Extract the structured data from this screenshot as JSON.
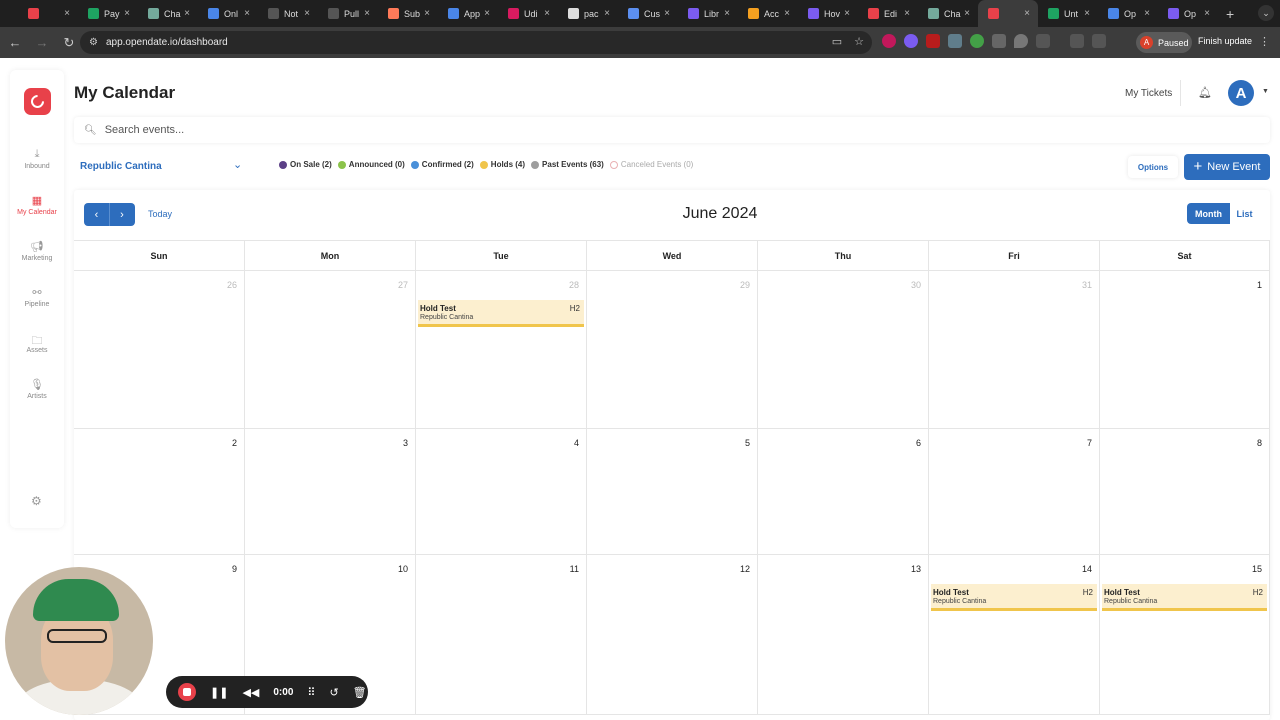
{
  "browser": {
    "tabs": [
      {
        "label": "",
        "icon": "chrome-icon",
        "color": "#e8414a"
      },
      {
        "label": "Pay",
        "icon": "sheets-icon",
        "color": "#1ea362"
      },
      {
        "label": "Cha",
        "icon": "chatgpt-icon",
        "color": "#74aa9c"
      },
      {
        "label": "Onl",
        "icon": "docs-icon",
        "color": "#4a86e8"
      },
      {
        "label": "Not",
        "icon": "github-icon",
        "color": "#555555"
      },
      {
        "label": "Pull",
        "icon": "github-icon",
        "color": "#555555"
      },
      {
        "label": "Sub",
        "icon": "hubspot-icon",
        "color": "#ff7a59"
      },
      {
        "label": "App",
        "icon": "app-icon",
        "color": "#4a86e8"
      },
      {
        "label": "Udi",
        "icon": "udi-icon",
        "color": "#d81b60"
      },
      {
        "label": "pac",
        "icon": "google-icon",
        "color": "#dddddd"
      },
      {
        "label": "Cus",
        "icon": "cube-icon",
        "color": "#5c8ff0"
      },
      {
        "label": "Libr",
        "icon": "gear-color-icon",
        "color": "#7b5cf0"
      },
      {
        "label": "Acc",
        "icon": "acc-icon",
        "color": "#f4a020"
      },
      {
        "label": "Hov",
        "icon": "gear-color-icon",
        "color": "#7b5cf0"
      },
      {
        "label": "Edi",
        "icon": "opendate-icon",
        "color": "#e8414a"
      },
      {
        "label": "Cha",
        "icon": "chatgpt-icon",
        "color": "#74aa9c"
      },
      {
        "label": "",
        "icon": "opendate-icon",
        "color": "#e8414a",
        "active": true
      },
      {
        "label": "Unt",
        "icon": "sheets-icon",
        "color": "#1ea362"
      },
      {
        "label": "Op",
        "icon": "op-icon",
        "color": "#4a86e8"
      },
      {
        "label": "Op",
        "icon": "gear-color-icon",
        "color": "#7b5cf0"
      }
    ],
    "url": "app.opendate.io/dashboard",
    "profile_status": "Paused",
    "profile_initial": "A",
    "finish_update": "Finish update"
  },
  "sidebar": {
    "items": [
      {
        "label": "Inbound",
        "icon": "inbox-icon"
      },
      {
        "label": "My Calendar",
        "icon": "calendar-icon",
        "active": true
      },
      {
        "label": "Marketing",
        "icon": "megaphone-icon"
      },
      {
        "label": "Pipeline",
        "icon": "pipeline-icon"
      },
      {
        "label": "Assets",
        "icon": "folder-icon"
      },
      {
        "label": "Artists",
        "icon": "microphone-icon"
      }
    ]
  },
  "header": {
    "title": "My Calendar",
    "my_tickets": "My Tickets",
    "avatar_initial": "A"
  },
  "search": {
    "placeholder": "Search events..."
  },
  "filters": {
    "venue": "Republic Cantina",
    "legend": [
      {
        "label": "On Sale (2)",
        "color": "#5b3f86"
      },
      {
        "label": "Announced (0)",
        "color": "#8bc34a"
      },
      {
        "label": "Confirmed (2)",
        "color": "#4a90d9"
      },
      {
        "label": "Holds (4)",
        "color": "#f0c54c"
      },
      {
        "label": "Past Events (63)",
        "color": "#9e9e9e"
      },
      {
        "label": "Canceled Events (0)",
        "color": "#ffffff",
        "muted": true
      }
    ],
    "options_label": "Options",
    "new_event_label": "New Event"
  },
  "calendar": {
    "month_title": "June 2024",
    "today_label": "Today",
    "view_month": "Month",
    "view_list": "List",
    "weekdays": [
      "Sun",
      "Mon",
      "Tue",
      "Wed",
      "Thu",
      "Fri",
      "Sat"
    ],
    "weeks": [
      [
        {
          "day": "26",
          "other": true
        },
        {
          "day": "27",
          "other": true
        },
        {
          "day": "28",
          "other": true,
          "event": {
            "name": "Hold Test",
            "venue": "Republic Cantina",
            "hold": "H2"
          }
        },
        {
          "day": "29",
          "other": true
        },
        {
          "day": "30",
          "other": true
        },
        {
          "day": "31",
          "other": true
        },
        {
          "day": "1"
        }
      ],
      [
        {
          "day": "2"
        },
        {
          "day": "3"
        },
        {
          "day": "4"
        },
        {
          "day": "5"
        },
        {
          "day": "6"
        },
        {
          "day": "7"
        },
        {
          "day": "8"
        }
      ],
      [
        {
          "day": "9"
        },
        {
          "day": "10"
        },
        {
          "day": "11"
        },
        {
          "day": "12"
        },
        {
          "day": "13"
        },
        {
          "day": "14",
          "event": {
            "name": "Hold Test",
            "venue": "Republic Cantina",
            "hold": "H2"
          }
        },
        {
          "day": "15",
          "event": {
            "name": "Hold Test",
            "venue": "Republic Cantina",
            "hold": "H2"
          }
        }
      ]
    ]
  },
  "recorder": {
    "timer": "0:00"
  },
  "colors": {
    "brand": "#e8414a",
    "accent": "#2d6dbd",
    "hold_bg": "#fcefcf",
    "hold_border": "#f0c54c"
  }
}
